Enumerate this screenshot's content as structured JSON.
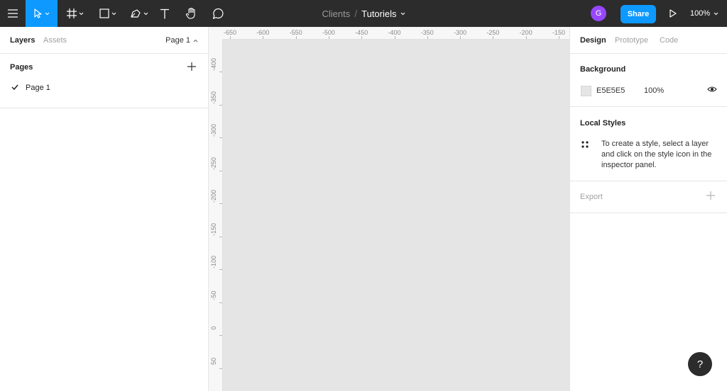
{
  "toolbar": {
    "tools": [
      {
        "name": "main-menu",
        "icon": "hamburger-menu-icon"
      },
      {
        "name": "move-tool",
        "icon": "cursor-arrow-icon",
        "active": true
      },
      {
        "name": "frame-tool",
        "icon": "frame-hash-icon"
      },
      {
        "name": "shape-tool",
        "icon": "rectangle-icon"
      },
      {
        "name": "pen-tool",
        "icon": "pen-nib-icon"
      },
      {
        "name": "text-tool",
        "icon": "text-T-icon"
      },
      {
        "name": "hand-tool",
        "icon": "hand-icon"
      },
      {
        "name": "comment-tool",
        "icon": "speech-bubble-icon"
      }
    ],
    "breadcrumb": {
      "parent": "Clients",
      "separator": "/",
      "file": "Tutoriels"
    },
    "avatar_initial": "G",
    "share_label": "Share",
    "zoom_label": "100%",
    "accent_color": "#0d99ff",
    "avatar_color": "#9747ff"
  },
  "left_panel": {
    "tabs": {
      "layers": "Layers",
      "assets": "Assets"
    },
    "page_select": "Page 1",
    "pages_title": "Pages",
    "pages": [
      {
        "name": "Page 1",
        "selected": true
      }
    ]
  },
  "rulers": {
    "top": [
      "-650",
      "-600",
      "-550",
      "-500",
      "-450",
      "-400",
      "-350",
      "-300",
      "-250",
      "-200",
      "-150"
    ],
    "left": [
      "-400",
      "-350",
      "-300",
      "-250",
      "-200",
      "-150",
      "-100",
      "-50",
      "0",
      "50"
    ]
  },
  "right_panel": {
    "tabs": {
      "design": "Design",
      "prototype": "Prototype",
      "code": "Code"
    },
    "background": {
      "title": "Background",
      "hex": "E5E5E5",
      "opacity": "100%",
      "color": "#e5e5e5"
    },
    "local_styles": {
      "title": "Local Styles",
      "hint": "To create a style, select a layer and click on the style icon in the inspector panel."
    },
    "export": {
      "title": "Export"
    }
  },
  "help_label": "?"
}
